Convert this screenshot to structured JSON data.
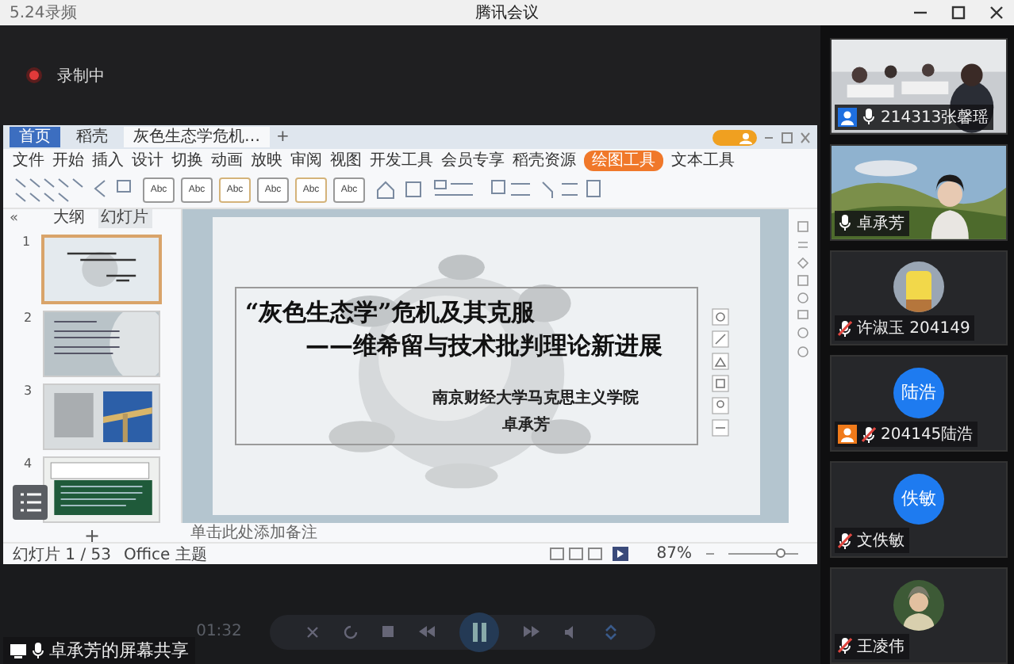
{
  "window": {
    "recording_file": "5.24录频",
    "title": "腾讯会议"
  },
  "recording": {
    "label": "录制中"
  },
  "presentation": {
    "tabs": [
      {
        "label": "首页",
        "selected": false
      },
      {
        "label": "稻壳",
        "selected": false
      },
      {
        "label": "灰色生态学危机…",
        "selected": true
      }
    ],
    "new_tab_symbol": "+",
    "collapse_symbol": "«",
    "add_slide_symbol": "+",
    "zoom_slider": {
      "level": 0.75
    },
    "menu": [
      {
        "label": "文件",
        "selected": false
      },
      {
        "label": "开始",
        "selected": false
      },
      {
        "label": "插入",
        "selected": false
      },
      {
        "label": "设计",
        "selected": false
      },
      {
        "label": "切换",
        "selected": false
      },
      {
        "label": "动画",
        "selected": false
      },
      {
        "label": "放映",
        "selected": false
      },
      {
        "label": "审阅",
        "selected": false
      },
      {
        "label": "视图",
        "selected": false
      },
      {
        "label": "开发工具",
        "selected": false
      },
      {
        "label": "会员专享",
        "selected": false
      },
      {
        "label": "稻壳资源",
        "selected": false
      },
      {
        "label": "绘图工具",
        "selected": true
      },
      {
        "label": "文本工具",
        "selected": false
      }
    ],
    "style_presets": [
      "Abc",
      "Abc",
      "Abc",
      "Abc",
      "Abc",
      "Abc"
    ],
    "pane_tabs": [
      {
        "label": "大纲",
        "selected": false
      },
      {
        "label": "幻灯片",
        "selected": true
      }
    ],
    "thumbnails": [
      {
        "number": "1",
        "selected": true
      },
      {
        "number": "2",
        "selected": false
      },
      {
        "number": "3",
        "selected": false
      },
      {
        "number": "4",
        "selected": false
      }
    ],
    "slide": {
      "title": "“灰色生态学”危机及其克服",
      "subtitle": "——维希留与技术批判理论新进展",
      "institution": "南京财经大学马克思主义学院",
      "author": "卓承芳"
    },
    "notes_placeholder": "单击此处添加备注",
    "status": {
      "slide_count": "幻灯片 1 / 53",
      "theme": "Office 主题",
      "zoom": "87%"
    }
  },
  "player": {
    "time": "01:32"
  },
  "share_label": "卓承芳的屏幕共享",
  "participants": [
    {
      "kind": "video",
      "name": "214313张馨瑶",
      "muted": false,
      "color": "#1e6fe0"
    },
    {
      "kind": "video",
      "name": "卓承芳",
      "muted": false
    },
    {
      "kind": "avatar",
      "name": "许淑玉 204149",
      "muted": true
    },
    {
      "kind": "initials",
      "initials": "陆浩",
      "name": "204145陆浩",
      "muted": true,
      "color": "#f07a1a"
    },
    {
      "kind": "initials",
      "initials": "佚敏",
      "name": "文佚敏",
      "muted": true
    },
    {
      "kind": "avatar",
      "name": "王凌伟",
      "muted": true
    }
  ]
}
